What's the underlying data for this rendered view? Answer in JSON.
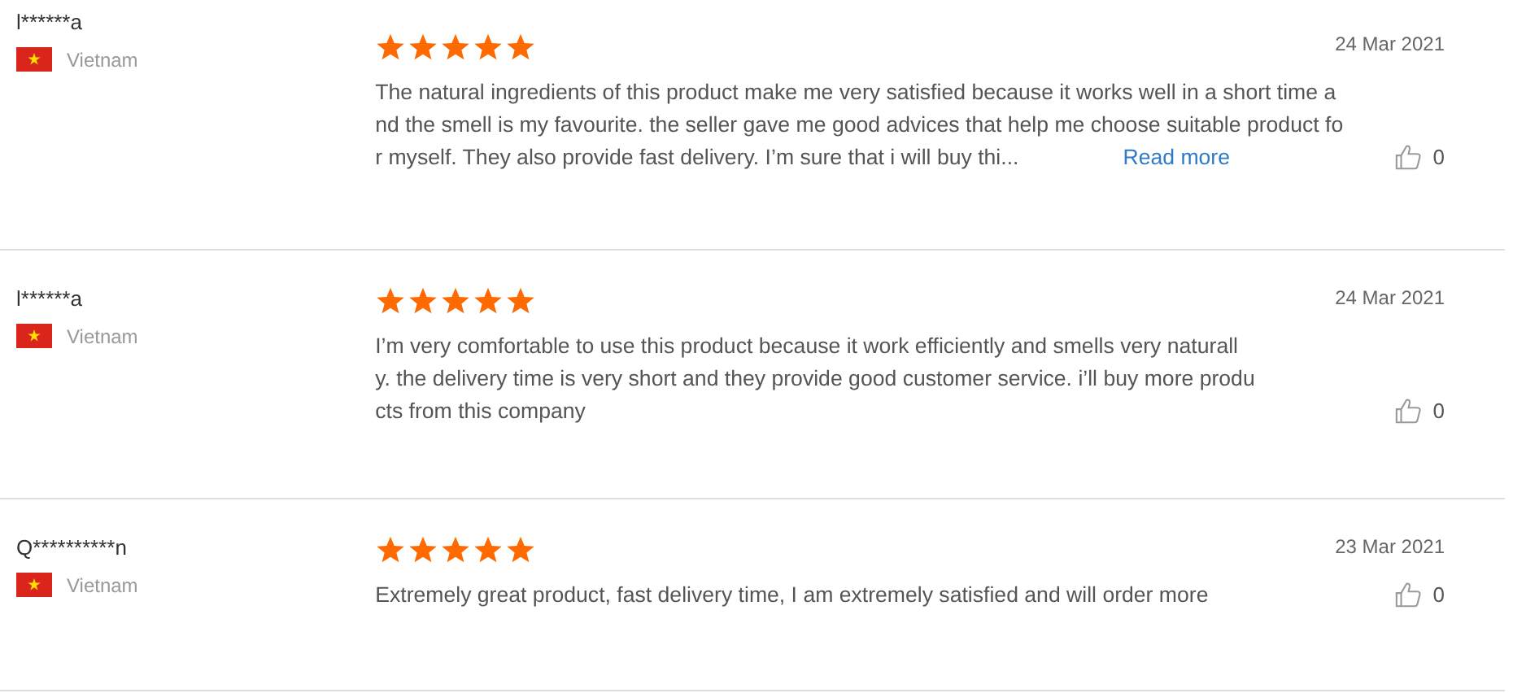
{
  "reviews": [
    {
      "reviewer": "l******a",
      "country": "Vietnam",
      "stars": 5,
      "date": "24 Mar 2021",
      "text_lines": [
        "The natural ingredients of this product make me very satisfied because it works well in a short time a",
        "nd the smell is my favourite. the seller gave me good advices that help me choose suitable product fo",
        "r myself. They also provide fast delivery. I’m sure that i will buy thi..."
      ],
      "read_more": "Read more",
      "likes": "0"
    },
    {
      "reviewer": "l******a",
      "country": "Vietnam",
      "stars": 5,
      "date": "24 Mar 2021",
      "text_lines": [
        "I’m very comfortable to use this product because it work efficiently and smells very naturall",
        "y. the delivery time is very short and they provide good customer service. i’ll buy more produ",
        "cts from this company"
      ],
      "likes": "0"
    },
    {
      "reviewer": "Q**********n",
      "country": "Vietnam",
      "stars": 5,
      "date": "23 Mar 2021",
      "text_lines": [
        "Extremely great product, fast delivery time, I am extremely satisfied and will order more"
      ],
      "likes": "0"
    }
  ]
}
